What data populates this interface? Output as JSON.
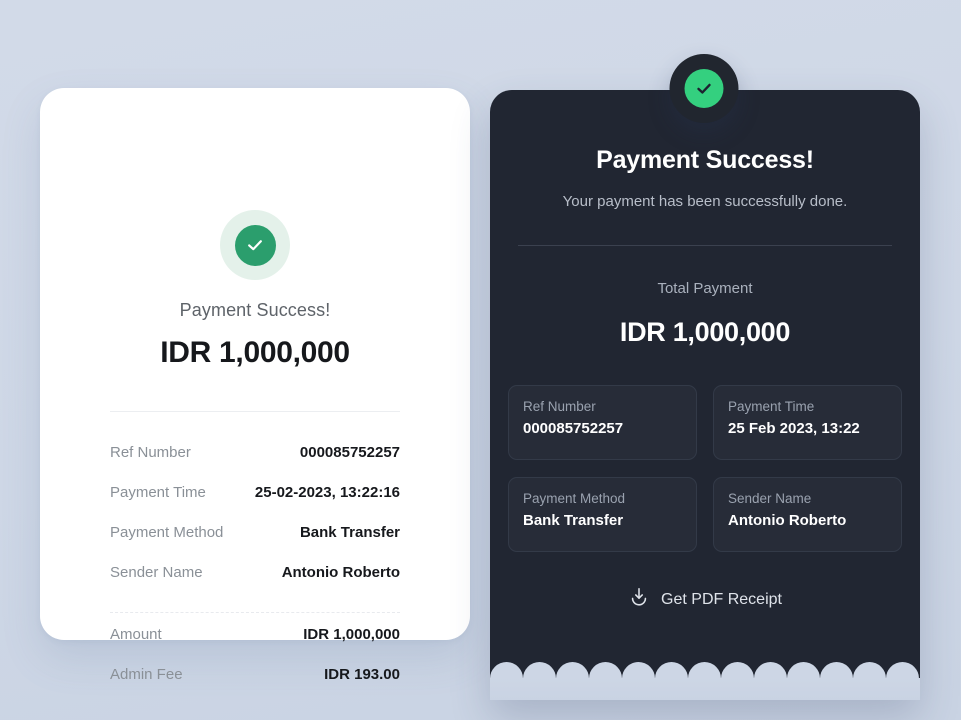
{
  "colors": {
    "page_background": "#ced7e6",
    "light_card_bg": "#ffffff",
    "dark_card_bg": "#212632",
    "accent_green_light": "#2b9e6d",
    "accent_green_dark": "#34d07f",
    "info_box_bg": "#272c38"
  },
  "light_card": {
    "badge_icon": "check-circle-icon",
    "title": "Payment Success!",
    "amount": "IDR 1,000,000",
    "rows": [
      {
        "label": "Ref Number",
        "value": "000085752257"
      },
      {
        "label": "Payment Time",
        "value": "25-02-2023, 13:22:16"
      },
      {
        "label": "Payment Method",
        "value": "Bank Transfer"
      },
      {
        "label": "Sender Name",
        "value": "Antonio Roberto"
      }
    ],
    "totals": [
      {
        "label": "Amount",
        "value": "IDR 1,000,000"
      },
      {
        "label": "Admin Fee",
        "value": "IDR 193.00"
      }
    ]
  },
  "dark_card": {
    "badge_icon": "check-circle-icon",
    "title": "Payment Success!",
    "subtitle": "Your payment has been successfully done.",
    "total_label": "Total Payment",
    "total_amount": "IDR 1,000,000",
    "info_boxes": [
      {
        "label": "Ref Number",
        "value": "000085752257"
      },
      {
        "label": "Payment Time",
        "value": "25 Feb 2023, 13:22"
      },
      {
        "label": "Payment Method",
        "value": "Bank Transfer"
      },
      {
        "label": "Sender Name",
        "value": "Antonio Roberto"
      }
    ],
    "pdf_action": {
      "icon": "download-icon",
      "label": "Get PDF Receipt"
    }
  }
}
